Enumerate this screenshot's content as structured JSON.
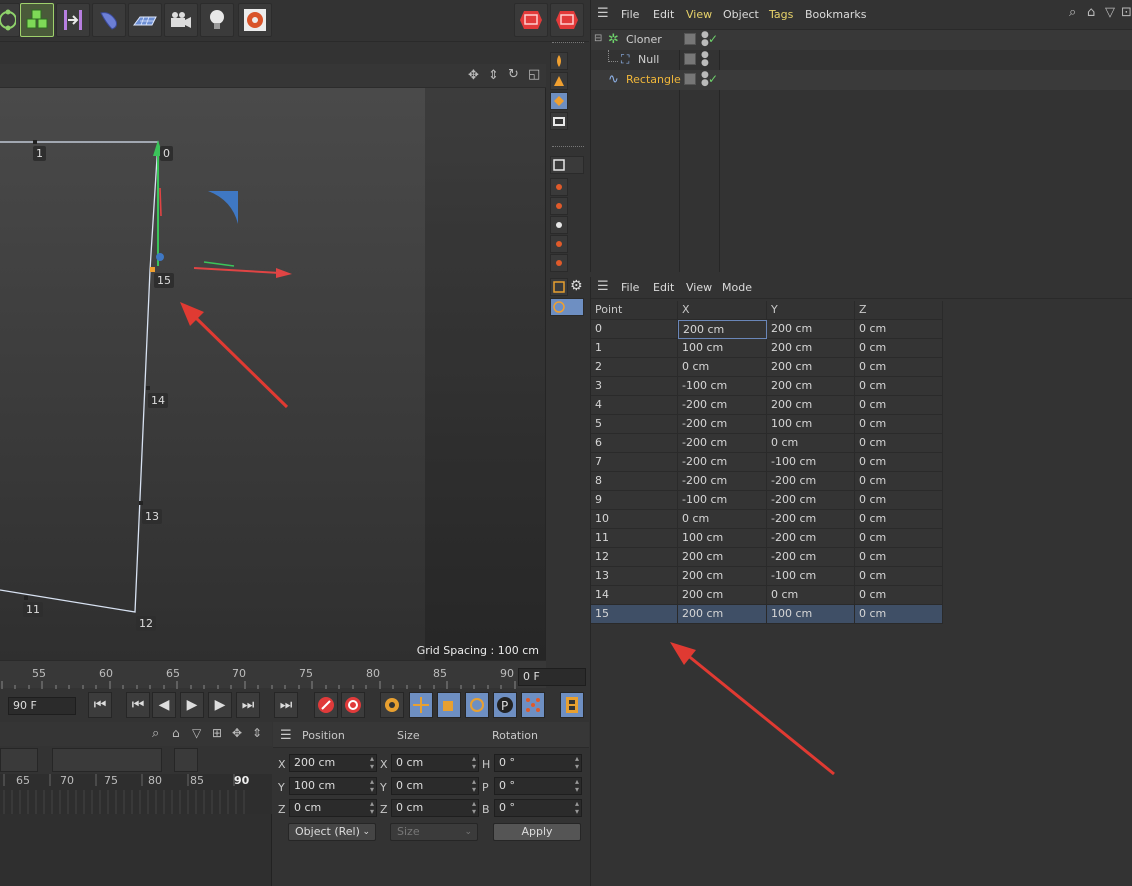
{
  "object_manager": {
    "menu": [
      "File",
      "Edit",
      "View",
      "Object",
      "Tags",
      "Bookmarks"
    ],
    "objects": [
      {
        "name": "Cloner",
        "icon": "cloner-icon",
        "level": 0
      },
      {
        "name": "Null",
        "icon": "null-icon",
        "level": 1
      },
      {
        "name": "Rectangle",
        "icon": "spline-icon",
        "level": 0,
        "selected": true
      }
    ]
  },
  "structure_manager": {
    "menu": [
      "File",
      "Edit",
      "View",
      "Mode"
    ],
    "columns": [
      "Point",
      "X",
      "Y",
      "Z"
    ],
    "rows": [
      [
        "0",
        "200 cm",
        "200 cm",
        "0 cm"
      ],
      [
        "1",
        "100 cm",
        "200 cm",
        "0 cm"
      ],
      [
        "2",
        "0 cm",
        "200 cm",
        "0 cm"
      ],
      [
        "3",
        "-100 cm",
        "200 cm",
        "0 cm"
      ],
      [
        "4",
        "-200 cm",
        "200 cm",
        "0 cm"
      ],
      [
        "5",
        "-200 cm",
        "100 cm",
        "0 cm"
      ],
      [
        "6",
        "-200 cm",
        "0 cm",
        "0 cm"
      ],
      [
        "7",
        "-200 cm",
        "-100 cm",
        "0 cm"
      ],
      [
        "8",
        "-200 cm",
        "-200 cm",
        "0 cm"
      ],
      [
        "9",
        "-100 cm",
        "-200 cm",
        "0 cm"
      ],
      [
        "10",
        "0 cm",
        "-200 cm",
        "0 cm"
      ],
      [
        "11",
        "100 cm",
        "-200 cm",
        "0 cm"
      ],
      [
        "12",
        "200 cm",
        "-200 cm",
        "0 cm"
      ],
      [
        "13",
        "200 cm",
        "-100 cm",
        "0 cm"
      ],
      [
        "14",
        "200 cm",
        "0 cm",
        "0 cm"
      ],
      [
        "15",
        "200 cm",
        "100 cm",
        "0 cm"
      ]
    ],
    "selected_row": "15"
  },
  "viewport": {
    "point_labels": [
      "1",
      "0",
      "15",
      "14",
      "13",
      "11",
      "12"
    ],
    "grid_spacing": "Grid Spacing : 100 cm"
  },
  "timeline": {
    "ruler_ticks": [
      "55",
      "60",
      "65",
      "70",
      "75",
      "80",
      "85",
      "90"
    ],
    "current_frame": "0 F",
    "end_frame": "90 F",
    "small_ruler_ticks": [
      "65",
      "70",
      "75",
      "80",
      "85",
      "90"
    ]
  },
  "coordinates": {
    "headers": [
      "Position",
      "Size",
      "Rotation"
    ],
    "rows": [
      {
        "axis": "X",
        "pos": "200 cm",
        "size_axis": "X",
        "size": "0 cm",
        "rot_axis": "H",
        "rot": "0 °"
      },
      {
        "axis": "Y",
        "pos": "100 cm",
        "size_axis": "Y",
        "size": "0 cm",
        "rot_axis": "P",
        "rot": "0 °"
      },
      {
        "axis": "Z",
        "pos": "0 cm",
        "size_axis": "Z",
        "size": "0 cm",
        "rot_axis": "B",
        "rot": "0 °"
      }
    ],
    "mode_select": "Object (Rel)",
    "size_select": "Size",
    "apply_label": "Apply"
  },
  "colors": {
    "accent_blue": "#6e8fc2",
    "selection_orange": "#f0b73a",
    "annotation_red": "#e03a32",
    "axis_green": "#3bc45a",
    "axis_red": "#e04444",
    "axis_blue": "#3f78c4"
  }
}
